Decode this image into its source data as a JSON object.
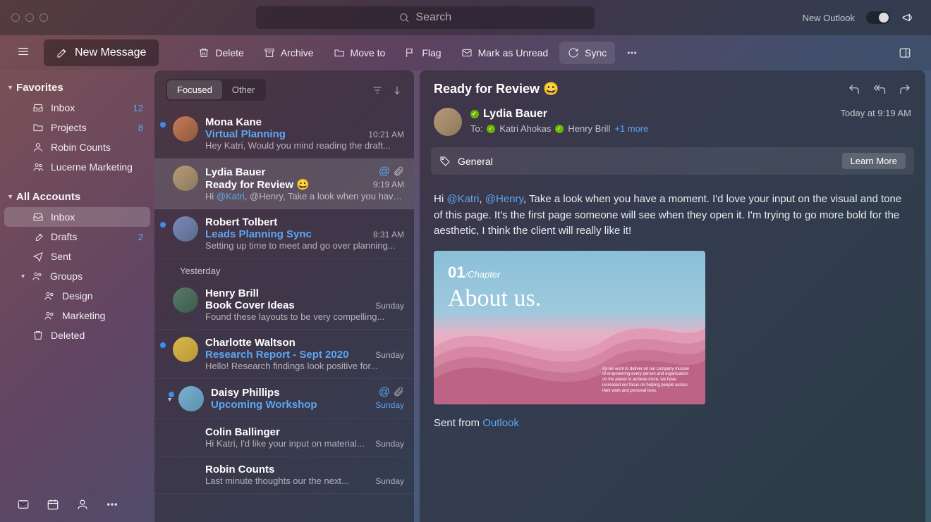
{
  "titlebar": {
    "search_placeholder": "Search",
    "new_outlook_label": "New Outlook"
  },
  "toolbar": {
    "new_message": "New Message",
    "delete": "Delete",
    "archive": "Archive",
    "move_to": "Move to",
    "flag": "Flag",
    "mark_unread": "Mark as Unread",
    "sync": "Sync"
  },
  "sidebar": {
    "favorites_label": "Favorites",
    "all_accounts_label": "All Accounts",
    "favorites": [
      {
        "label": "Inbox",
        "count": "12"
      },
      {
        "label": "Projects",
        "count": "8"
      },
      {
        "label": "Robin Counts"
      },
      {
        "label": "Lucerne Marketing"
      }
    ],
    "accounts": [
      {
        "label": "Inbox"
      },
      {
        "label": "Drafts",
        "count": "2"
      },
      {
        "label": "Sent"
      },
      {
        "label": "Groups"
      },
      {
        "label": "Design"
      },
      {
        "label": "Marketing"
      },
      {
        "label": "Deleted"
      }
    ]
  },
  "list": {
    "tab_focused": "Focused",
    "tab_other": "Other",
    "yesterday_label": "Yesterday",
    "messages": [
      {
        "sender": "Mona Kane",
        "subject": "Virtual Planning",
        "time": "10:21 AM",
        "preview": "Hey Katri, Would you mind reading the draft...",
        "unread": true
      },
      {
        "sender": "Lydia Bauer",
        "subject": "Ready for Review 😀",
        "time": "9:19 AM",
        "preview_pre": "Hi ",
        "preview_mention": "@Katri",
        "preview_post": ", @Henry, Take a look when you have..."
      },
      {
        "sender": "Robert Tolbert",
        "subject": "Leads Planning Sync",
        "time": "8:31 AM",
        "preview": "Setting up time to meet and go over planning...",
        "unread": true
      },
      {
        "sender": "Henry Brill",
        "subject": "Book Cover Ideas",
        "time": "Sunday",
        "preview": "Found these layouts to be very compelling..."
      },
      {
        "sender": "Charlotte Waltson",
        "subject": "Research Report - Sept 2020",
        "time": "Sunday",
        "preview": "Hello! Research findings look positive for...",
        "unread": true
      },
      {
        "sender": "Daisy Phillips",
        "subject": "Upcoming Workshop",
        "time": "Sunday",
        "unread": true
      },
      {
        "sender": "Colin Ballinger",
        "time": "Sunday",
        "preview": "Hi Katri, I'd like your input on material..."
      },
      {
        "sender": "Robin Counts",
        "time": "Sunday",
        "preview": "Last minute thoughts our the next..."
      }
    ]
  },
  "reading": {
    "subject": "Ready for Review 😀",
    "sender": "Lydia Bauer",
    "timestamp": "Today at 9:19 AM",
    "to_label": "To:",
    "recipients": [
      {
        "name": "Katri Ahokas"
      },
      {
        "name": "Henry Brill"
      }
    ],
    "more_recipients": "+1 more",
    "category": "General",
    "learn_more": "Learn More",
    "body_greeting": "Hi ",
    "body_m1": "@Katri",
    "body_sep": ", ",
    "body_m2": "@Henry",
    "body_text": ", Take a look when you have a moment. I'd love your input on the visual and tone of this page. It's the first page someone will see when they open it. I'm trying to go more bold for the aesthetic, I think the client will really like it!",
    "image": {
      "chapter_num": "01",
      "chapter_label": "Chapter",
      "title": "About us.",
      "body": "As we work to deliver on our company mission of empowering every person and organization on the planet to achieve more, we have increased our focus on helping people across their work and personal lives."
    },
    "signature_pre": "Sent from ",
    "signature_link": "Outlook"
  }
}
